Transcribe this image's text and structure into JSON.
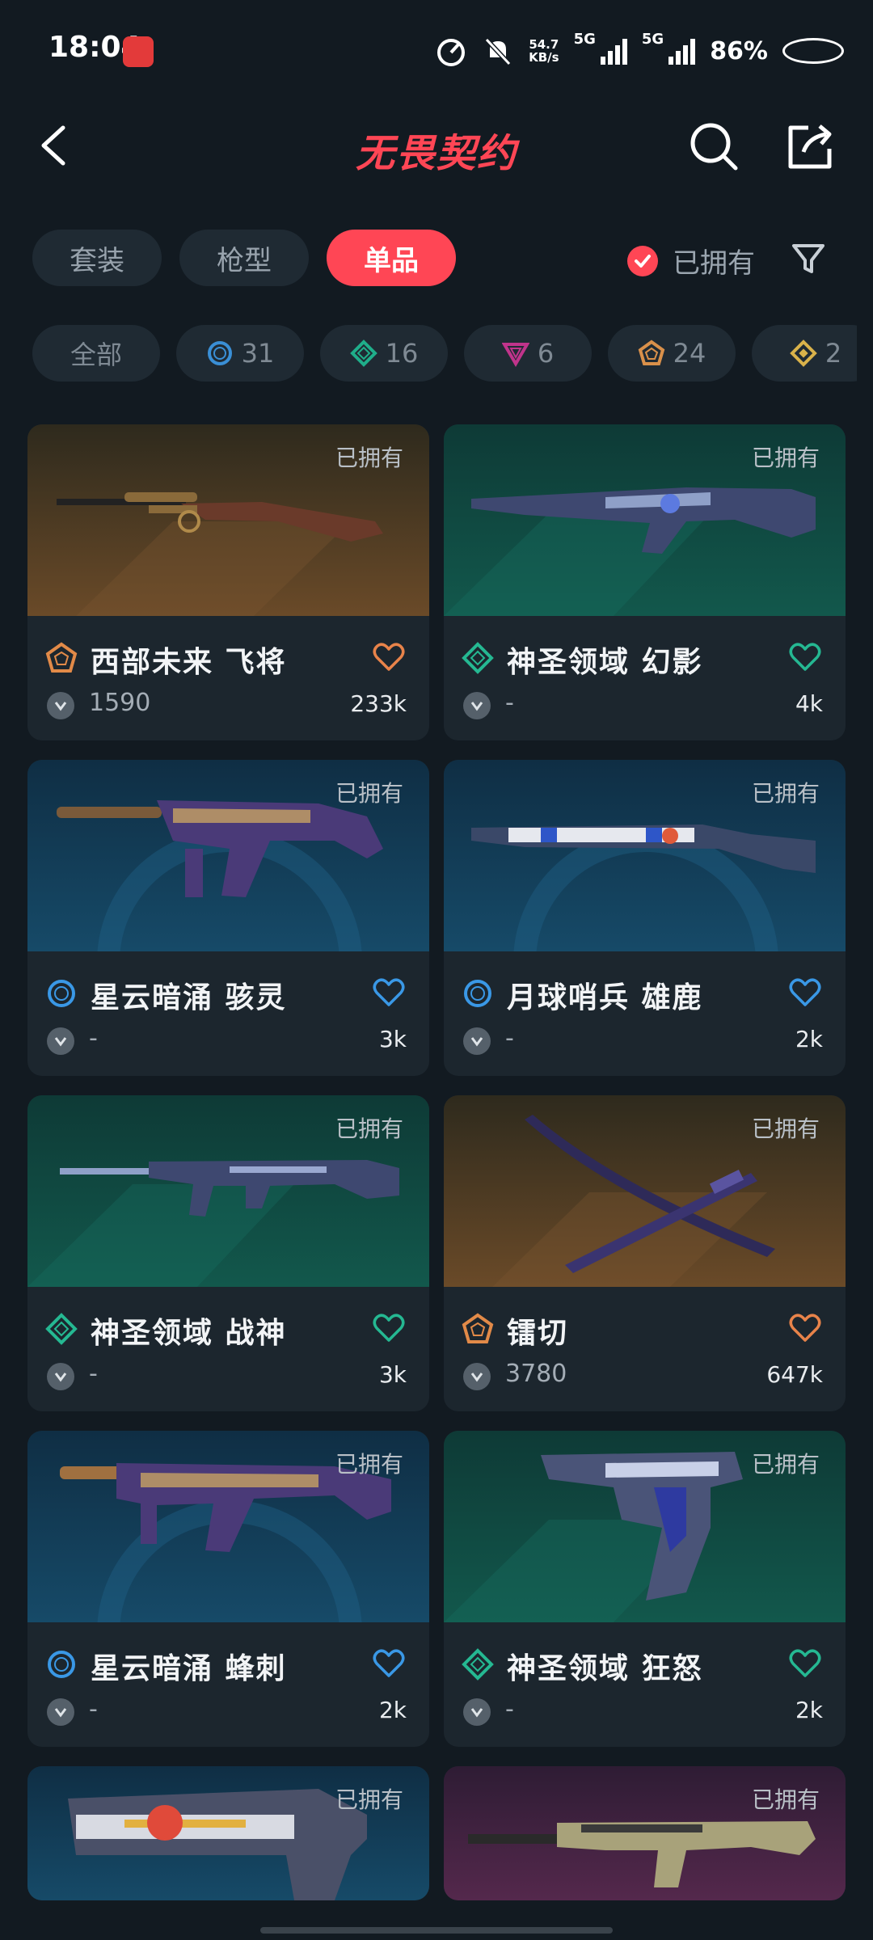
{
  "status": {
    "time": "18:04",
    "net_speed": "54.7",
    "net_unit": "KB/s",
    "sim1": "5G",
    "sim2": "5G",
    "battery": "86%"
  },
  "header": {
    "title": "无畏契约"
  },
  "tabs": [
    {
      "label": "套装"
    },
    {
      "label": "枪型"
    },
    {
      "label": "单品"
    }
  ],
  "owned_filter": {
    "label": "已拥有",
    "checked": true
  },
  "chips": [
    {
      "label": "全部"
    },
    {
      "icon": "select-tier-icon",
      "count": "31",
      "color": "#3a8fd6"
    },
    {
      "icon": "deluxe-tier-icon",
      "count": "16",
      "color": "#1fae8a"
    },
    {
      "icon": "premium-tier-icon",
      "count": "6",
      "color": "#c0348b"
    },
    {
      "icon": "exclusive-tier-icon",
      "count": "24",
      "color": "#d9904a"
    },
    {
      "icon": "ultra-tier-icon",
      "count": "2",
      "color": "#d9b24a"
    }
  ],
  "cards": [
    {
      "owned": "已拥有",
      "name": "西部未来 飞将",
      "price": "1590",
      "likes": "233k",
      "tier": "exclusive",
      "tier_color": "#e28a48",
      "heart_color": "#e8834a",
      "weapon": "rifle-marshal"
    },
    {
      "owned": "已拥有",
      "name": "神圣领域 幻影",
      "price": "-",
      "likes": "4k",
      "tier": "deluxe",
      "tier_color": "#25b892",
      "heart_color": "#25b892",
      "weapon": "phantom"
    },
    {
      "owned": "已拥有",
      "name": "星云暗涌 骇灵",
      "price": "-",
      "likes": "3k",
      "tier": "select",
      "tier_color": "#3a98e6",
      "heart_color": "#3a98e6",
      "weapon": "spectre-gold"
    },
    {
      "owned": "已拥有",
      "name": "月球哨兵 雄鹿",
      "price": "-",
      "likes": "2k",
      "tier": "select",
      "tier_color": "#3a98e6",
      "heart_color": "#3a98e6",
      "weapon": "bucky"
    },
    {
      "owned": "已拥有",
      "name": "神圣领域 战神",
      "price": "-",
      "likes": "3k",
      "tier": "deluxe",
      "tier_color": "#25b892",
      "heart_color": "#25b892",
      "weapon": "ares"
    },
    {
      "owned": "已拥有",
      "name": "镭切",
      "price": "3780",
      "likes": "647k",
      "tier": "exclusive",
      "tier_color": "#e28a48",
      "heart_color": "#e8834a",
      "weapon": "blades"
    },
    {
      "owned": "已拥有",
      "name": "星云暗涌 蜂刺",
      "price": "-",
      "likes": "2k",
      "tier": "select",
      "tier_color": "#3a98e6",
      "heart_color": "#3a98e6",
      "weapon": "stinger"
    },
    {
      "owned": "已拥有",
      "name": "神圣领域 狂怒",
      "price": "-",
      "likes": "2k",
      "tier": "deluxe",
      "tier_color": "#25b892",
      "heart_color": "#25b892",
      "weapon": "frenzy"
    },
    {
      "owned": "已拥有",
      "weapon": "sheriff"
    },
    {
      "owned": "已拥有",
      "weapon": "guardian"
    }
  ]
}
